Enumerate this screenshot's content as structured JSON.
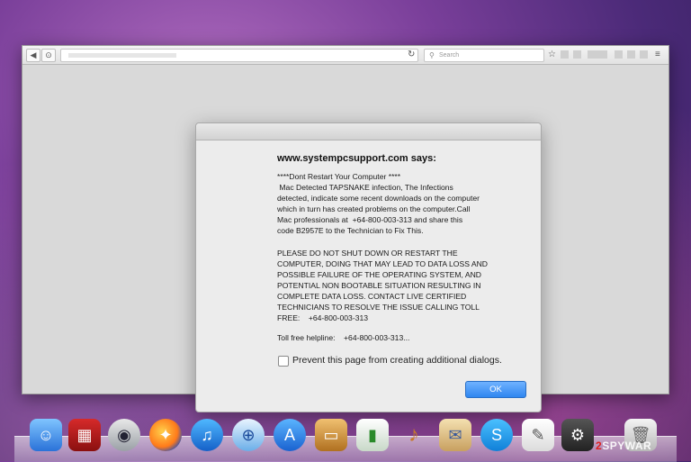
{
  "browser": {
    "search_placeholder": "Search",
    "icons": [
      "back-icon",
      "reload-icon",
      "search-icon",
      "star-icon",
      "menu-icon"
    ]
  },
  "dialog": {
    "title": "www.systempcsupport.com says:",
    "paragraph1": "****Dont Restart Your Computer ****\n Mac Detected TAPSNAKE infection, The Infections\ndetected, indicate some recent downloads on the computer\nwhich in turn has created problems on the computer.Call\nMac professionals at  +64-800-003-313 and share this\ncode B2957E to the Technician to Fix This.",
    "paragraph2": "PLEASE DO NOT SHUT DOWN OR RESTART THE\nCOMPUTER, DOING THAT MAY LEAD TO DATA LOSS AND\nPOSSIBLE FAILURE OF THE OPERATING SYSTEM, AND\nPOTENTIAL NON BOOTABLE SITUATION RESULTING IN\nCOMPLETE DATA LOSS. CONTACT LIVE CERTIFIED\nTECHNICIANS TO RESOLVE THE ISSUE CALLING TOLL\nFREE:    +64-800-003-313",
    "helpline": "Toll free helpline:    +64-800-003-313...",
    "checkbox_label": "Prevent this page from creating additional dialogs.",
    "checkbox_checked": false,
    "ok_label": "OK"
  },
  "dock": {
    "apps": [
      "finder-icon",
      "photo-booth-icon",
      "facetime-icon",
      "firefox-icon",
      "itunes-icon",
      "safari-icon",
      "app-store-icon",
      "keynote-icon",
      "numbers-icon",
      "garageband-icon",
      "mail-icon",
      "skype-icon",
      "textedit-icon",
      "steam-icon",
      "trash-icon"
    ]
  },
  "watermark": {
    "prefix": "2",
    "suffix": "SPYWAR"
  },
  "colors": {
    "accent": "#2f86f0",
    "desktop": "#5a2f86"
  }
}
